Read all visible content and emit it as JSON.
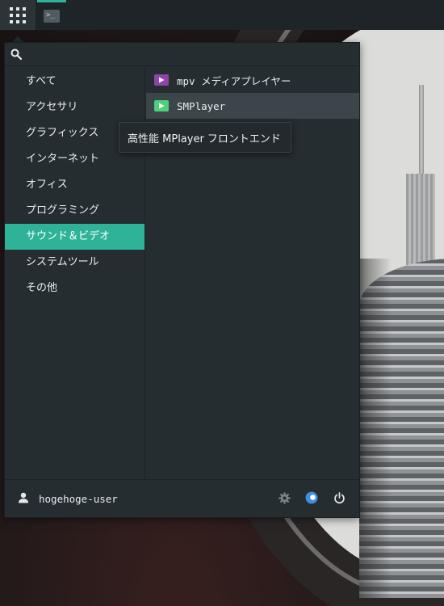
{
  "top_panel": {
    "apps_button_icon": "app-grid-icon",
    "task_terminal_icon": "terminal-icon",
    "task_terminal_glyph": ">_"
  },
  "menu": {
    "search": {
      "icon": "search-icon",
      "value": "",
      "placeholder": ""
    },
    "categories": [
      {
        "label": "すべて",
        "active": false
      },
      {
        "label": "アクセサリ",
        "active": false
      },
      {
        "label": "グラフィックス",
        "active": false
      },
      {
        "label": "インターネット",
        "active": false
      },
      {
        "label": "オフィス",
        "active": false
      },
      {
        "label": "プログラミング",
        "active": false
      },
      {
        "label": "サウンド＆ビデオ",
        "active": true
      },
      {
        "label": "システムツール",
        "active": false
      },
      {
        "label": "その他",
        "active": false
      }
    ],
    "apps": [
      {
        "name": "mpv メディアプレイヤー",
        "icon": "mpv-play-icon",
        "icon_color": "#8e44ad",
        "hovered": false
      },
      {
        "name": "SMPlayer",
        "icon": "smplayer-play-icon",
        "icon_color": "#4cd07d",
        "hovered": true
      }
    ],
    "tooltip": "高性能 MPlayer フロントエンド",
    "footer": {
      "user_icon": "user-icon",
      "user_name": "hogehoge-user",
      "settings_icon": "gear-icon",
      "lock_icon": "lock-screen-icon",
      "power_icon": "power-icon"
    }
  },
  "colors": {
    "accent": "#2eb398",
    "menu_bg": "#252d31",
    "hover_bg": "#3c4549",
    "text": "#e9eef0"
  }
}
